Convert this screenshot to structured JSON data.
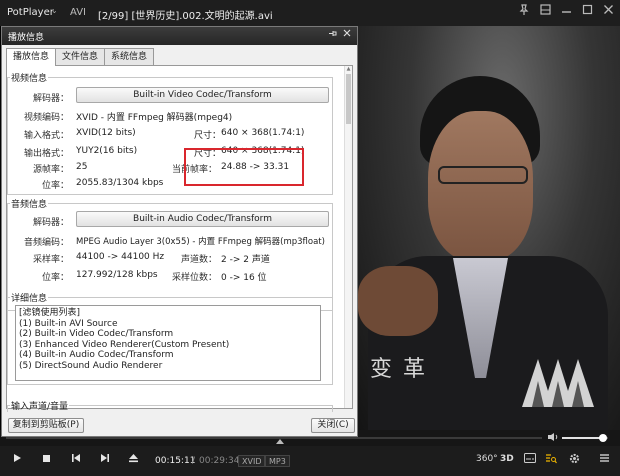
{
  "titlebar": {
    "app_name": "PotPlayer",
    "app_caret": "⌄",
    "format": "AVI",
    "file_title": "[2/99] [世界历史].002.文明的起源.avi",
    "buttons": [
      "pin",
      "minimize-compact",
      "minimize",
      "maximize",
      "close"
    ]
  },
  "video": {
    "caption": "变 革"
  },
  "dialog": {
    "title": "播放信息",
    "tabs": [
      "播放信息",
      "文件信息",
      "系统信息"
    ],
    "active_tab": "播放信息",
    "video_info": {
      "group_label": "视频信息",
      "decoder_label": "解码器：",
      "decoder_button": "Built-in Video Codec/Transform",
      "codec_label": "视频编码：",
      "codec_value": "XVID - 内置 FFmpeg 解码器(mpeg4)",
      "input_label": "输入格式：",
      "input_value": "XVID(12 bits)",
      "input_size_label": "尺寸：",
      "input_size_value": "640 × 368(1.74:1)",
      "output_label": "输出格式：",
      "output_value": "YUY2(16 bits)",
      "output_size_label": "尺寸：",
      "output_size_value": "640 × 368(1.74:1)",
      "fps_label": "源帧率：",
      "fps_value": "25",
      "cur_fps_label": "当前帧率：",
      "cur_fps_value": "24.88 -> 33.31",
      "bitrate_label": "位率：",
      "bitrate_value": "2055.83/1304 kbps"
    },
    "audio_info": {
      "group_label": "音频信息",
      "decoder_label": "解码器：",
      "decoder_button": "Built-in Audio Codec/Transform",
      "codec_label": "音频编码：",
      "codec_value": "MPEG Audio Layer 3(0x55) - 内置 FFmpeg 解码器(mp3float)",
      "samplerate_label": "采样率：",
      "samplerate_value": "44100 -> 44100 Hz",
      "channels_label": "声道数：",
      "channels_value": "2 -> 2 声道",
      "bitrate_label": "位率：",
      "bitrate_value": "127.992/128 kbps",
      "bits_label": "采样位数：",
      "bits_value": "0 -> 16 位"
    },
    "details": {
      "group_label": "详细信息",
      "items": [
        "[滤镜使用列表]",
        "(1) Built-in AVI Source",
        "(2) Built-in Video Codec/Transform",
        "(3) Enhanced Video Renderer(Custom Present)",
        "(4) Built-in Audio Codec/Transform",
        "(5) DirectSound Audio Renderer"
      ]
    },
    "input_channel_label": "输入声道/音量",
    "copy_button": "复制到剪贴板(P)",
    "close_button": "关闭(C)"
  },
  "controls": {
    "current_time": "00:15:11",
    "separator": "/",
    "total_time": "00:29:34",
    "badges": [
      "XVID",
      "MP3"
    ],
    "right_labels": [
      "360°",
      "3D"
    ],
    "seek_progress": 0.513,
    "volume_level": 0.9
  },
  "colors": {
    "highlight": "#d9262d",
    "player_bg": "#1c1c1c",
    "dialog_bg": "#f0f0f0"
  }
}
